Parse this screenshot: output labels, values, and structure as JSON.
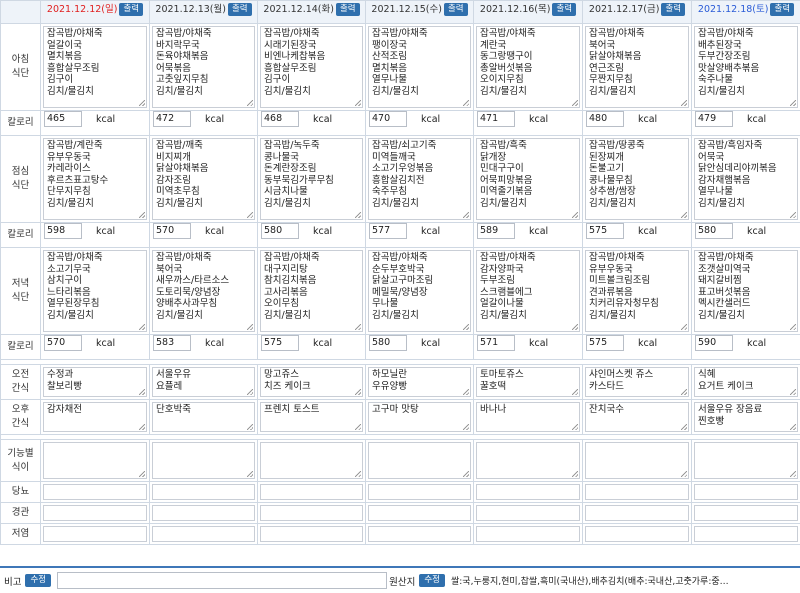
{
  "header": {
    "print_label": "출력",
    "days": [
      {
        "date": "2021.12.12(일)",
        "type": "sun"
      },
      {
        "date": "2021.12.13(월)",
        "type": "wd"
      },
      {
        "date": "2021.12.14(화)",
        "type": "wd"
      },
      {
        "date": "2021.12.15(수)",
        "type": "wd"
      },
      {
        "date": "2021.12.16(목)",
        "type": "wd"
      },
      {
        "date": "2021.12.17(금)",
        "type": "wd"
      },
      {
        "date": "2021.12.18(토)",
        "type": "sat"
      }
    ]
  },
  "labels": {
    "breakfast": "아침\n식단",
    "lunch": "점심\n식단",
    "dinner": "저녁\n식단",
    "calorie": "칼로리",
    "am_snack": "오전\n간식",
    "pm_snack": "오후\n간식",
    "functional": "기능별\n식이",
    "diabetes": "당뇨",
    "tube": "경관",
    "low_salt": "저염",
    "kcal_unit": "kcal"
  },
  "breakfast": {
    "menus": [
      "잡곡밥/야채죽\n얼갈이국\n멸치볶음\n흥합살무조림\n김구이\n김치/물김치",
      "잡곡밥/야채죽\n바지락무국\n돈육야채볶음\n어묵볶음\n고춧잎지무침\n김치/물김치",
      "잡곡밥/야채죽\n시래기된장국\n비엔나케찹볶음\n흥합살무조림\n김구이\n김치/물김치",
      "잡곡밥/야채죽\n팽이장국\n산적조림\n멸치볶음\n열무나물\n김치/물김치",
      "잡곡밥/야채죽\n계란국\n동그랑땡구이\n총알버섯볶음\n오이지무침\n김치/물김치",
      "잡곡밥/야채죽\n북어국\n닭살야채볶음\n연근조림\n무짠지무침\n김치/물김치",
      "잡곡밥/야채죽\n배추된장국\n두부간장조림\n맛살양배추볶음\n숙주나물\n김치/물김치"
    ],
    "kcal": [
      "465",
      "472",
      "468",
      "470",
      "471",
      "480",
      "479"
    ]
  },
  "lunch": {
    "menus": [
      "잡곡밥/계란죽\n유부우동국\n카레라이스\n후르츠표고탕수\n단무지무침\n김치/물김치",
      "잡곡밥/깨죽\n비지찌개\n닭살야채볶음\n감자조림\n미역초무침\n김치/물김치",
      "잡곡밥/녹두죽\n콩나물국\n돈계란장조림\n동부묵김가루무침\n시금치나물\n김치/물김치",
      "잡곡밥/쇠고기죽\n미역들깨국\n소고기우엉볶음\n흥합살김치전\n숙주무침\n김치/물김치",
      "잡곡밥/흑죽\n닭개장\n민대구구이\n어묵피망볶음\n미역줄기볶음\n김치/물김치",
      "잡곡밥/땅콩죽\n된장찌개\n돈불고기\n콩나물무침\n상추쌈/쌈장\n김치/물김치",
      "잡곡밥/흑임자죽\n어묵국\n닭안심데리야끼볶음\n감자채햄볶음\n열무나물\n김치/물김치"
    ],
    "kcal": [
      "598",
      "570",
      "580",
      "577",
      "589",
      "575",
      "580"
    ]
  },
  "dinner": {
    "menus": [
      "잡곡밥/야채죽\n소고기무국\n삼치구이\n느타리볶음\n열무된장무침\n김치/물김치",
      "잡곡밥/야채죽\n북어국\n새우까스/타르소스\n도토리묵/양념장\n양배추사과무침\n김치/물김치",
      "잡곡밥/야채죽\n대구지리탕\n참치김치볶음\n고사리볶음\n오이무침\n김치/물김치",
      "잡곡밥/야채죽\n순두부호박국\n닭살고구마조림\n메밀묵/양념장\n무나물\n김치/물김치",
      "잡곡밥/야채죽\n감자양파국\n두부조림\n스크램블에그\n얼갈이나물\n김치/물김치",
      "잡곡밥/야채죽\n유부우동국\n미트볼크림조림\n견과류볶음\n치커리유자청무침\n김치/물김치",
      "잡곡밥/야채죽\n조갯살미역국\n돼지갈비찜\n표고버섯볶음\n멕시칸샐러드\n김치/물김치"
    ],
    "kcal": [
      "570",
      "583",
      "575",
      "580",
      "571",
      "575",
      "590"
    ]
  },
  "am_snack": [
    "수정과\n찰보리빵",
    "서울우유\n요플레",
    "망고쥬스\n치즈 케이크",
    "하모닐란\n우유양빵",
    "토마토쥬스\n꿀호떡",
    "샤인머스켓 쥬스\n카스타드",
    "식혜\n요거트 케이크"
  ],
  "pm_snack": [
    "감자채전",
    "단호박죽",
    "프렌치 토스트",
    "고구마 맛탕",
    "바나나",
    "잔치국수",
    "서울우유 장음료\n찐호빵"
  ],
  "footer": {
    "remarks_label": "비고",
    "edit_label": "수정",
    "origin_label": "원산지",
    "origin_text": "쌀:국,누룽지,현미,찹쌀,흑미(국내산),배추김치(배추:국내산,고춧가루:중…"
  }
}
